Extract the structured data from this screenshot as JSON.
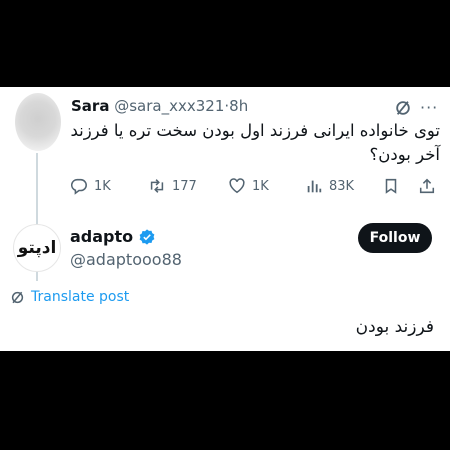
{
  "original_tweet": {
    "author_name": "Sara",
    "handle": "@sara_xxx321",
    "separator": "·",
    "time": "8h",
    "text": "توی خانواده ایرانی فرزند اول بودن سخت تره یا فرزند آخر بودن؟",
    "actions": {
      "replies": "1K",
      "retweets": "177",
      "likes": "1K",
      "views": "83K"
    }
  },
  "reply_tweet": {
    "author_name": "adapto",
    "handle": "@adaptooo88",
    "avatar_text": "ادپتو",
    "follow_label": "Follow",
    "translate_label": "Translate post",
    "text": "فرزند بودن"
  },
  "colors": {
    "accent": "#1d9bf0",
    "text": "#0f1419",
    "muted": "#536471",
    "follow_bg": "#0f1419"
  }
}
